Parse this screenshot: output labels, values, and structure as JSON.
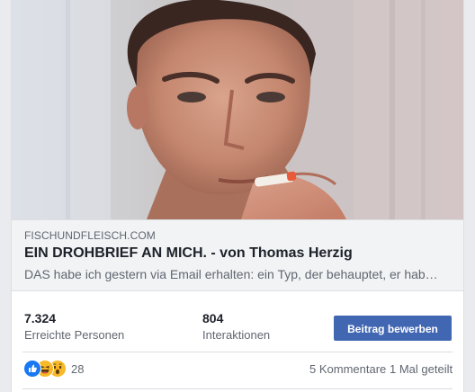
{
  "link": {
    "domain": "FISCHUNDFLEISCH.COM",
    "title": "EIN DROHBRIEF AN MICH. - von Thomas Herzig",
    "description": "DAS habe ich gestern via Email erhalten: ein Typ, der behauptet, er hab…"
  },
  "stats": {
    "reach_value": "7.324",
    "reach_label": "Erreichte Personen",
    "interactions_value": "804",
    "interactions_label": "Interaktionen",
    "boost_label": "Beitrag bewerben"
  },
  "reactions": {
    "icons": [
      "like-icon",
      "haha-icon",
      "wow-icon"
    ],
    "count": "28",
    "comments": "5 Kommentare",
    "shares": "1 Mal geteilt"
  },
  "colors": {
    "accent": "#4267b2",
    "like": "#1877f2",
    "emoji": "#f7b928"
  }
}
